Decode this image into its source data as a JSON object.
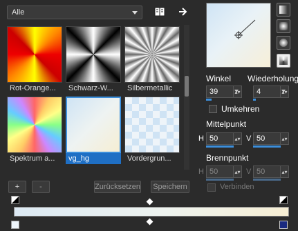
{
  "toolbar": {
    "category": "Alle",
    "icons": [
      "book-icon",
      "arrow-right-icon"
    ]
  },
  "gallery": {
    "items": [
      {
        "label": "Rot-Orange...",
        "selected": false
      },
      {
        "label": "Schwarz-W...",
        "selected": false
      },
      {
        "label": "Silbermetallic",
        "selected": false
      },
      {
        "label": "Spektrum a...",
        "selected": false
      },
      {
        "label": "vg_hg",
        "selected": true
      },
      {
        "label": "Vordergrun...",
        "selected": false
      }
    ]
  },
  "controls": {
    "angle_label": "Winkel",
    "angle_value": "39",
    "repeat_label": "Wiederholung",
    "repeat_value": "4",
    "invert_label": "Umkehren",
    "center_label": "Mittelpunkt",
    "center_h_label": "H",
    "center_h": "50",
    "center_v_label": "V",
    "center_v": "50",
    "focus_label": "Brennpunkt",
    "focus_h_label": "H",
    "focus_h": "50",
    "focus_v_label": "V",
    "focus_v": "50",
    "link_label": "Verbinden"
  },
  "buttons": {
    "add": "+",
    "remove": "-",
    "reset": "Zurücksetzen",
    "save": "Speichern"
  },
  "colors": {
    "accent": "#3c8fdc",
    "background": "#2b2b2b"
  }
}
